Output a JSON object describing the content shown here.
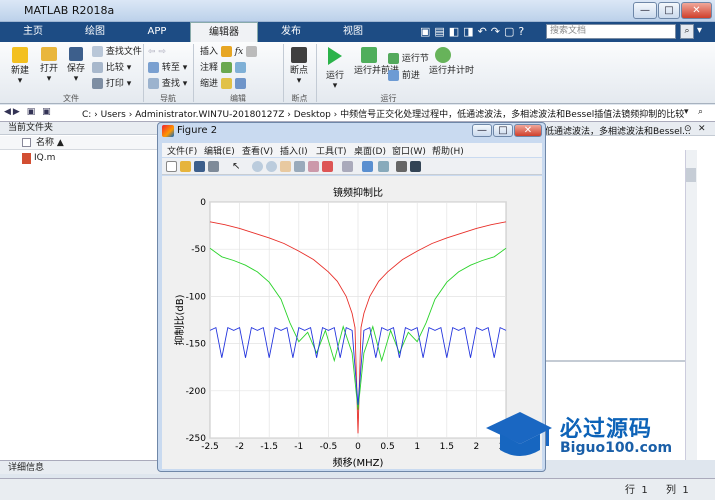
{
  "window": {
    "title": "MATLAB R2018a",
    "minimize": "—",
    "maximize": "□",
    "close": "✕"
  },
  "tabs": [
    {
      "label": "主页"
    },
    {
      "label": "绘图"
    },
    {
      "label": "APP"
    },
    {
      "label": "编辑器"
    },
    {
      "label": "发布"
    },
    {
      "label": "视图"
    }
  ],
  "search": {
    "placeholder": "搜索文档"
  },
  "ribbon": {
    "file": {
      "new": "新建",
      "open": "打开",
      "save": "保存",
      "find_files": "查找文件",
      "compare": "比较",
      "print": "打印",
      "group": "文件"
    },
    "navigate": {
      "goto": "转至",
      "find": "查找",
      "group": "导航"
    },
    "edit": {
      "insert": "插入",
      "comment": "注释",
      "indent": "缩进",
      "fx": "fx",
      "group": "编辑"
    },
    "breakpoints": {
      "breakpoint": "断点",
      "group": "断点"
    },
    "run": {
      "run": "运行",
      "run_advance": "运行并前进",
      "run_section": "运行节",
      "advance": "前进",
      "run_time": "运行并计时",
      "group": "运行"
    }
  },
  "address": {
    "path": "C: › Users › Administrator.WIN7U-20180127Z › Desktop › 中频信号正交化处理过程中，低通滤波法，多相滤波法和Bessel插值法镜频抑制的比较"
  },
  "left_pane": {
    "header": "当前文件夹",
    "column": "名称 ▲",
    "file": "IQ.m",
    "detail": "详细信息"
  },
  "right_pane": {
    "title": "低通滤波法，多相滤波法和Bessel..."
  },
  "figure": {
    "title": "Figure 2",
    "menus": [
      {
        "label": "文件(F)"
      },
      {
        "label": "编辑(E)"
      },
      {
        "label": "查看(V)"
      },
      {
        "label": "插入(I)"
      },
      {
        "label": "工具(T)"
      },
      {
        "label": "桌面(D)"
      },
      {
        "label": "窗口(W)"
      },
      {
        "label": "帮助(H)"
      }
    ]
  },
  "status": {
    "row_label": "行",
    "row": "1",
    "col_label": "列",
    "col": "1"
  },
  "watermark": {
    "line1": "必过源码",
    "line2": "Biguo100.com"
  },
  "chart_data": {
    "type": "line",
    "title": "镜频抑制比",
    "xlabel": "频移(MHZ)",
    "ylabel": "抑制比(dB)",
    "xlim": [
      -2.5,
      2.5
    ],
    "ylim": [
      -250,
      0
    ],
    "xticks": [
      "-2.5",
      "-2",
      "-1.5",
      "-1",
      "-0.5",
      "0",
      "0.5",
      "1",
      "1.5",
      "2",
      "2.5"
    ],
    "yticks": [
      "0",
      "-50",
      "-100",
      "-150",
      "-200",
      "-250"
    ],
    "grid": true,
    "series": [
      {
        "color": "#e8302a",
        "x": [
          -2.5,
          -2.25,
          -2,
          -1.75,
          -1.5,
          -1.25,
          -1,
          -0.75,
          -0.5,
          -0.35,
          -0.2,
          -0.1,
          -0.05,
          0,
          0.05,
          0.1,
          0.2,
          0.35,
          0.5,
          0.75,
          1,
          1.25,
          1.5,
          1.75,
          2,
          2.25,
          2.5
        ],
        "y": [
          -21,
          -24,
          -28,
          -33,
          -38,
          -44,
          -52,
          -61,
          -74,
          -84,
          -100,
          -118,
          -133,
          -245,
          -133,
          -118,
          -100,
          -84,
          -74,
          -61,
          -52,
          -44,
          -38,
          -33,
          -28,
          -24,
          -21
        ]
      },
      {
        "color": "#2bd32b",
        "x": [
          -2.5,
          -2.3,
          -2.1,
          -1.9,
          -1.7,
          -1.5,
          -1.3,
          -1.15,
          -1,
          -0.85,
          -0.7,
          -0.55,
          -0.4,
          -0.25,
          -0.1,
          0,
          0.1,
          0.25,
          0.4,
          0.55,
          0.7,
          0.85,
          1,
          1.15,
          1.3,
          1.5,
          1.7,
          1.9,
          2.1,
          2.3,
          2.5
        ],
        "y": [
          -49,
          -58,
          -62,
          -67,
          -74,
          -85,
          -103,
          -128,
          -148,
          -138,
          -160,
          -136,
          -168,
          -132,
          -160,
          -220,
          -160,
          -132,
          -168,
          -136,
          -160,
          -138,
          -148,
          -128,
          -103,
          -85,
          -74,
          -67,
          -62,
          -58,
          -49
        ]
      },
      {
        "color": "#2233dd",
        "x": [
          -2.5,
          -2.4,
          -2.3,
          -2.2,
          -2.1,
          -2,
          -1.9,
          -1.8,
          -1.7,
          -1.6,
          -1.5,
          -1.4,
          -1.3,
          -1.2,
          -1.1,
          -1,
          -0.9,
          -0.8,
          -0.7,
          -0.6,
          -0.5,
          -0.4,
          -0.3,
          -0.2,
          -0.1,
          0,
          0.1,
          0.2,
          0.3,
          0.4,
          0.5,
          0.6,
          0.7,
          0.8,
          0.9,
          1,
          1.1,
          1.2,
          1.3,
          1.4,
          1.5,
          1.6,
          1.7,
          1.8,
          1.9,
          2,
          2.1,
          2.2,
          2.3,
          2.4,
          2.5
        ],
        "y": [
          -136,
          -133,
          -165,
          -133,
          -136,
          -133,
          -165,
          -133,
          -136,
          -133,
          -165,
          -133,
          -136,
          -133,
          -165,
          -133,
          -136,
          -133,
          -165,
          -133,
          -136,
          -133,
          -165,
          -133,
          -136,
          -215,
          -136,
          -133,
          -165,
          -133,
          -136,
          -133,
          -165,
          -133,
          -136,
          -133,
          -165,
          -133,
          -136,
          -133,
          -165,
          -133,
          -136,
          -133,
          -165,
          -133,
          -136,
          -133,
          -165,
          -133,
          -136
        ]
      }
    ]
  }
}
